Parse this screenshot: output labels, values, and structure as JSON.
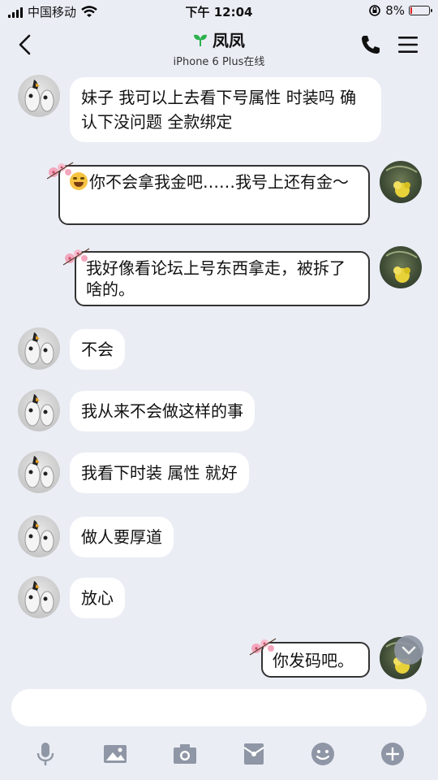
{
  "status_bar": {
    "carrier": "中国移动",
    "time": "下午 12:04",
    "battery": "8%"
  },
  "header": {
    "contact_name": "凤凤",
    "status": "iPhone 6 Plus在线"
  },
  "messages": [
    {
      "side": "left",
      "text": "妹子 我可以上去看下号属性 时装吗 确认下没问题 全款绑定"
    },
    {
      "side": "right",
      "emoji": "joy",
      "text": "你不会拿我金吧……我号上还有金～"
    },
    {
      "side": "right",
      "text": "我好像看论坛上号东西拿走，被拆了啥的。"
    },
    {
      "side": "left",
      "text": "不会"
    },
    {
      "side": "left",
      "text": "我从来不会做这样的事"
    },
    {
      "side": "left",
      "text": "我看下时装 属性 就好"
    },
    {
      "side": "left",
      "text": "做人要厚道"
    },
    {
      "side": "left",
      "text": "放心"
    },
    {
      "side": "right",
      "text": "你发码吧。"
    }
  ],
  "colors": {
    "background": "#ebedf5",
    "bubble": "#ffffff",
    "battery_low": "#e02020",
    "sprout": "#2bb24c",
    "toolbar_icon": "#8f96a5"
  },
  "toolbar": {
    "icons": [
      "microphone-icon",
      "image-icon",
      "camera-icon",
      "red-packet-icon",
      "emoji-icon",
      "plus-icon"
    ]
  }
}
